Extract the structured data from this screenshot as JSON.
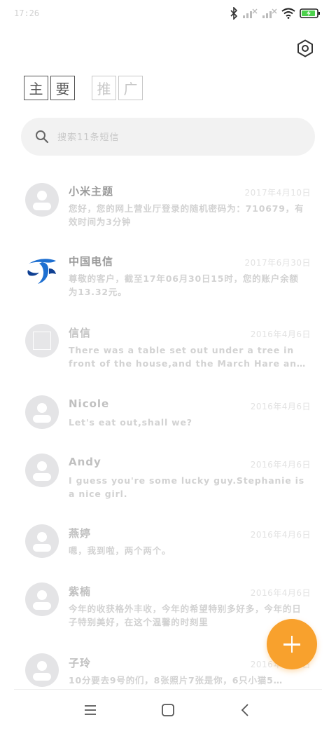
{
  "status_bar": {
    "time": "17:26",
    "icons": [
      "bluetooth-icon",
      "signal-icon",
      "signal-icon",
      "wifi-icon",
      "battery-charging-icon"
    ],
    "battery_color": "#4cd14c"
  },
  "header": {
    "settings_icon": "settings-hexagon-icon"
  },
  "tabs": [
    {
      "label_chars": [
        "主",
        "要"
      ],
      "active": true
    },
    {
      "label_chars": [
        "推",
        "广"
      ],
      "active": false
    }
  ],
  "search": {
    "placeholder": "搜索11条短信"
  },
  "conversations": [
    {
      "name": "小米主题",
      "date": "2017年4月10日",
      "preview": "您好，您的网上营业厅登录的随机密码为：710679，有效时间为3分钟",
      "avatar": "person"
    },
    {
      "name": "中国电信",
      "date": "2017年6月30日",
      "preview": "尊敬的客户，截至17年06月30日15时，您的账户余额为13.32元。",
      "avatar": "china-telecom-logo"
    },
    {
      "name": "信信",
      "date": "2016年4月6日",
      "preview": "There was a table set out under a tree in front of the house,and the March Hare an…",
      "avatar": "initial"
    },
    {
      "name": "Nicole",
      "date": "2016年4月6日",
      "preview": "Let's eat out,shall we?",
      "avatar": "person"
    },
    {
      "name": "Andy",
      "date": "2016年4月6日",
      "preview": "I guess you're some lucky guy.Stephanie is a nice girl.",
      "avatar": "person"
    },
    {
      "name": "燕婷",
      "date": "2016年4月6日",
      "preview": "嗯，我到啦，两个两个。",
      "avatar": "person"
    },
    {
      "name": "紫楠",
      "date": "2016年4月6日",
      "preview": "今年的收获格外丰收，今年的希望特别多好多，今年的日子特别美好，在这个温馨的时刻里",
      "avatar": "person"
    },
    {
      "name": "子玲",
      "date": "2016年4月6日",
      "preview": "10分要去9号的们，8张照片7张是你，6只小猫5…",
      "avatar": "person"
    }
  ],
  "fab": {
    "icon": "plus-icon",
    "color": "#f8a12d"
  },
  "nav_bar": {
    "icons": [
      "menu-icon",
      "home-square-icon",
      "back-chevron-icon"
    ]
  }
}
